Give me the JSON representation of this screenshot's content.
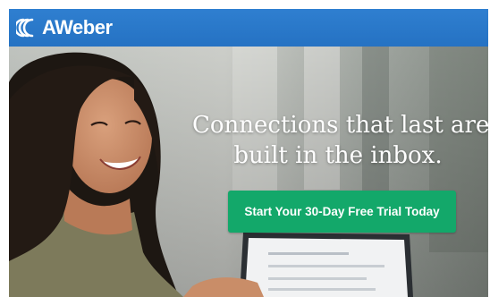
{
  "header": {
    "brand_name": "AWeber",
    "brand_color": "#2a77c8",
    "logo_icon": "aweber-logo-icon"
  },
  "hero": {
    "headline_line1": "Connections that last are",
    "headline_line2": "built in the inbox.",
    "cta_label": "Start Your 30-Day Free Trial Today",
    "cta_color": "#13a86a"
  }
}
